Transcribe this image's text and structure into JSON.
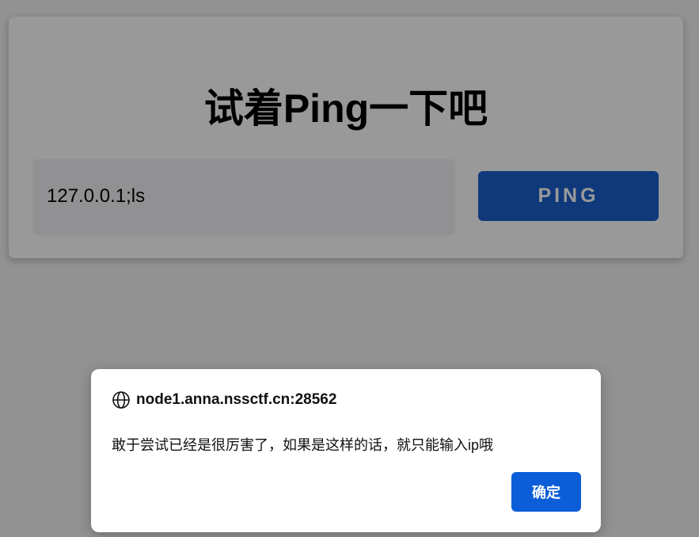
{
  "page": {
    "title": "试着Ping一下吧",
    "ip_input": {
      "value": "127.0.0.1;ls",
      "placeholder": ""
    },
    "ping_button_label": "PING"
  },
  "dialog": {
    "origin": "node1.anna.nssctf.cn:28562",
    "origin_icon": "globe-icon",
    "message": "敢于尝试已经是很厉害了，如果是这样的话，就只能输入ip哦",
    "ok_label": "确定"
  },
  "colors": {
    "ping_button": "#1a5fcc",
    "ok_button": "#0b5ed7",
    "overlay": "rgba(0,0,0,0.40)"
  }
}
